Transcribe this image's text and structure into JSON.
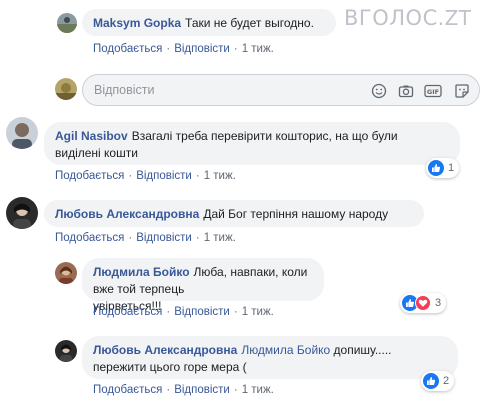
{
  "watermark": {
    "text": "ВГОЛОС",
    "suffix": ".ZT"
  },
  "actions_text": {
    "like": "Подобається",
    "reply": "Відповісти"
  },
  "comments": [
    {
      "author": "Maksym Gopka",
      "text": "Таки не будет выгодно.",
      "time": "1 тиж."
    },
    {
      "author": "Agil Nasibov",
      "text_line1": "Взагалі треба перевірити кошторис, на що були",
      "text_line2": "виділені кошти",
      "time": "1 тиж.",
      "reactions": "1"
    },
    {
      "author": "Любовь Александровна",
      "text": "Дай Бог терпіння нашому народу",
      "time": "1 тиж."
    }
  ],
  "replies": [
    {
      "author": "Людмила Бойко",
      "text_line1": "Люба, навпаки, коли вже той терпець",
      "text_line2": "увірветься!!!",
      "time": "1 тиж.",
      "reactions": "3"
    },
    {
      "author": "Любовь Александровна",
      "mention": "Людмила Бойко",
      "text_line1": "допишу.....",
      "text_line2": "пережити цього горе мера (",
      "time": "1 тиж.",
      "reactions": "2"
    }
  ],
  "reply_box": {
    "placeholder": "Відповісти"
  },
  "icons": [
    "emoji-icon",
    "camera-icon",
    "gif-icon",
    "sticker-icon",
    "like-icon",
    "love-icon"
  ],
  "colors": {
    "link": "#385898",
    "bubble": "#f2f3f5",
    "like": "#1877f2",
    "love": "#f33e58"
  }
}
